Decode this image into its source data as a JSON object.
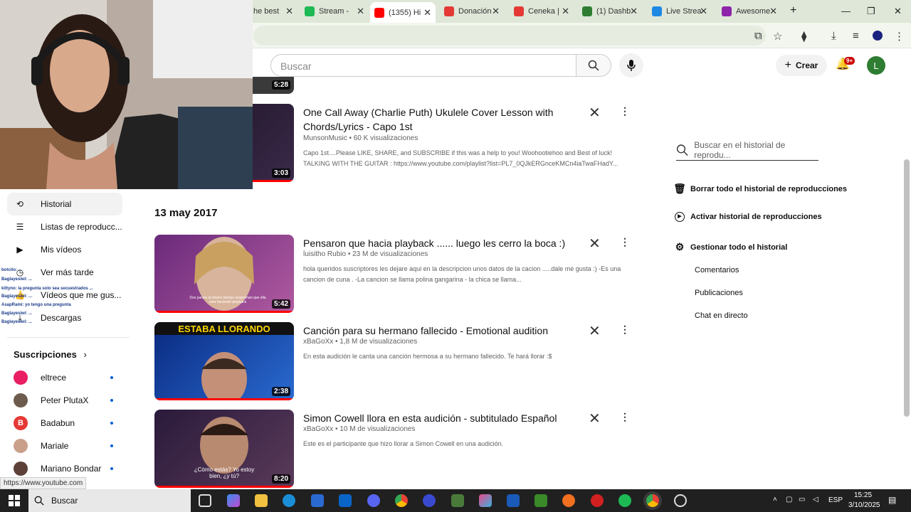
{
  "browser": {
    "tabs": [
      {
        "label": "he best",
        "color": "#a0a0a0"
      },
      {
        "label": "Stream -",
        "color": "#1db954"
      },
      {
        "label": "(1355) Hi",
        "color": "#ff0000"
      },
      {
        "label": "Donación",
        "color": "#e53935"
      },
      {
        "label": "Ceneka |",
        "color": "#e53935"
      },
      {
        "label": "(1) Dashb",
        "color": "#2e7d32"
      },
      {
        "label": "Live Strea",
        "color": "#1e88e5"
      },
      {
        "label": "Awesome",
        "color": "#8e24aa"
      }
    ],
    "close_glyph": "✕",
    "new_tab_glyph": "+",
    "window_controls": [
      "—",
      "❐",
      "✕"
    ]
  },
  "header": {
    "search_placeholder": "Buscar",
    "create_label": "Crear",
    "notifications_badge": "9+",
    "avatar_letter": "L"
  },
  "sidebar": {
    "items": [
      {
        "label": "Historial",
        "icon": "history-icon",
        "glyph": "⟲",
        "active": true
      },
      {
        "label": "Listas de reproducc...",
        "icon": "playlist-icon",
        "glyph": "☰",
        "active": false
      },
      {
        "label": "Mis vídeos",
        "icon": "my-videos-icon",
        "glyph": "▶",
        "active": false
      },
      {
        "label": "Ver más tarde",
        "icon": "watch-later-icon",
        "glyph": "◷",
        "active": false
      },
      {
        "label": "Vídeos que me gus...",
        "icon": "like-icon",
        "glyph": "👍",
        "active": false
      },
      {
        "label": "Descargas",
        "icon": "download-icon",
        "glyph": "⤓",
        "active": false
      }
    ],
    "subscriptions_title": "Suscripciones",
    "subscriptions": [
      {
        "name": "eltrece",
        "color": "#e91e63"
      },
      {
        "name": "Peter PlutaX",
        "color": "#6d5c4d"
      },
      {
        "name": "Badabun",
        "color": "#e53935"
      },
      {
        "name": "Mariale",
        "color": "#c9a08a"
      },
      {
        "name": "Mariano Bondar",
        "color": "#5d4037"
      }
    ]
  },
  "chat_overlay": [
    "botcito: ...",
    "Baglayesiwi: ...",
    "kittyno: la pregunta solo sea secuestrados ...",
    "Baglayesiwi: ...",
    "AsapRami: yo tengo una pregunta",
    "Baglayesiwi: ...",
    "Baglayesiwi: ..."
  ],
  "status_url": "https://www.youtube.com",
  "history": {
    "date_label": "13 may 2017",
    "videos": [
      {
        "title": "One Call Away (Charlie Puth) Ukulele Cover Lesson with Chords/Lyrics - Capo 1st",
        "meta": "MunsonMusic • 60 K visualizaciones",
        "description": "Capo 1st....Please LIKE, SHARE, and SUBSCRIBE if this was a help to you! Woohootiehoo and Best of luck! TALKING WITH THE GUITAR : https://www.youtube.com/playlist?list=PL7_0QJkERGnceKMCn4iaTwaFHadY...",
        "duration": "3:03",
        "thumb_color": "#2a1a2e"
      },
      {
        "title": "Pensaron que hacia playback ...... luego les cerro la boca :)",
        "meta": "luisitho Rubio • 23 M de visualizaciones",
        "description": "hola queridos suscriptores les dejare aqui en la descripcion unos datos de la cacion .....dale me gusta :) -Es una cancion de cuna . -La cancion se llama polina gangarina - la chica se llama...",
        "duration": "5:42",
        "thumb_color": "#8a3a8a"
      },
      {
        "title": "Canción para su hermano fallecido - Emotional audition",
        "meta": "xBaGoXx • 1,8 M de visualizaciones",
        "description": "En esta audición le canta una canción hermosa a su hermano fallecido. Te hará llorar :$",
        "duration": "2:38",
        "thumb_color": "#1a4aa0"
      },
      {
        "title": "Simon Cowell llora en esta audición - subtitulado Español",
        "meta": "xBaGoXx • 10 M de visualizaciones",
        "description": "Este es el participante que hizo llorar a Simon Cowell en una audición.",
        "duration": "8:20",
        "thumb_color": "#3a2a3a"
      }
    ],
    "prev_duration": "5:28",
    "thumb_captions": {
      "v2": "Dos jueces al mismo tiempo sospechan que ella esta haciendo playback",
      "v3": "ESTABA LLORANDO",
      "v4": "¿Cómo estás? Yo estoy bien, ¿y tú?"
    }
  },
  "right_panel": {
    "search_placeholder": "Buscar en el historial de reprodu...",
    "actions": [
      {
        "label": "Borrar todo el historial de reproducciones",
        "icon": "trash-icon",
        "glyph": "🗑"
      },
      {
        "label": "Activar historial de reproducciones",
        "icon": "play-circle-icon",
        "glyph": "▶"
      },
      {
        "label": "Gestionar todo el historial",
        "icon": "gear-icon",
        "glyph": "⚙"
      }
    ],
    "links": [
      "Comentarios",
      "Publicaciones",
      "Chat en directo"
    ]
  },
  "taskbar": {
    "search_label": "Buscar",
    "language": "ESP",
    "time": "15:25",
    "date": "3/10/2025"
  }
}
